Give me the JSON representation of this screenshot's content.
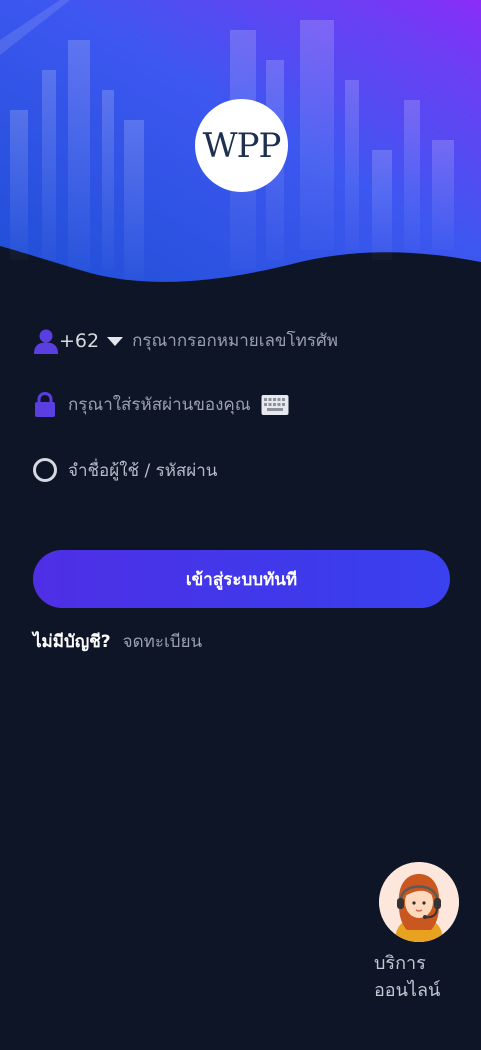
{
  "brand": {
    "logo_text": "WPP"
  },
  "phone": {
    "country_code": "+62",
    "placeholder": "กรุณากรอกหมายเลขโทรศัพ"
  },
  "password": {
    "placeholder": "กรุณาใส่รหัสผ่านของคุณ"
  },
  "remember": {
    "label": "จำชื่อผู้ใช้ / รหัสผ่าน"
  },
  "login": {
    "label": "เข้าสู่ระบบทันที"
  },
  "register": {
    "prompt": "ไม่มีบัญชี?",
    "link": "จดทะเบียน"
  },
  "support": {
    "label_line1": "บริการ",
    "label_line2": "ออนไลน์"
  },
  "colors": {
    "accent": "#4a3be8",
    "background": "#0e1527",
    "icon": "#5b3ee0"
  },
  "icons": [
    "user-icon",
    "caret-down-icon",
    "lock-icon",
    "keyboard-icon",
    "radio-icon",
    "support-agent-icon"
  ]
}
